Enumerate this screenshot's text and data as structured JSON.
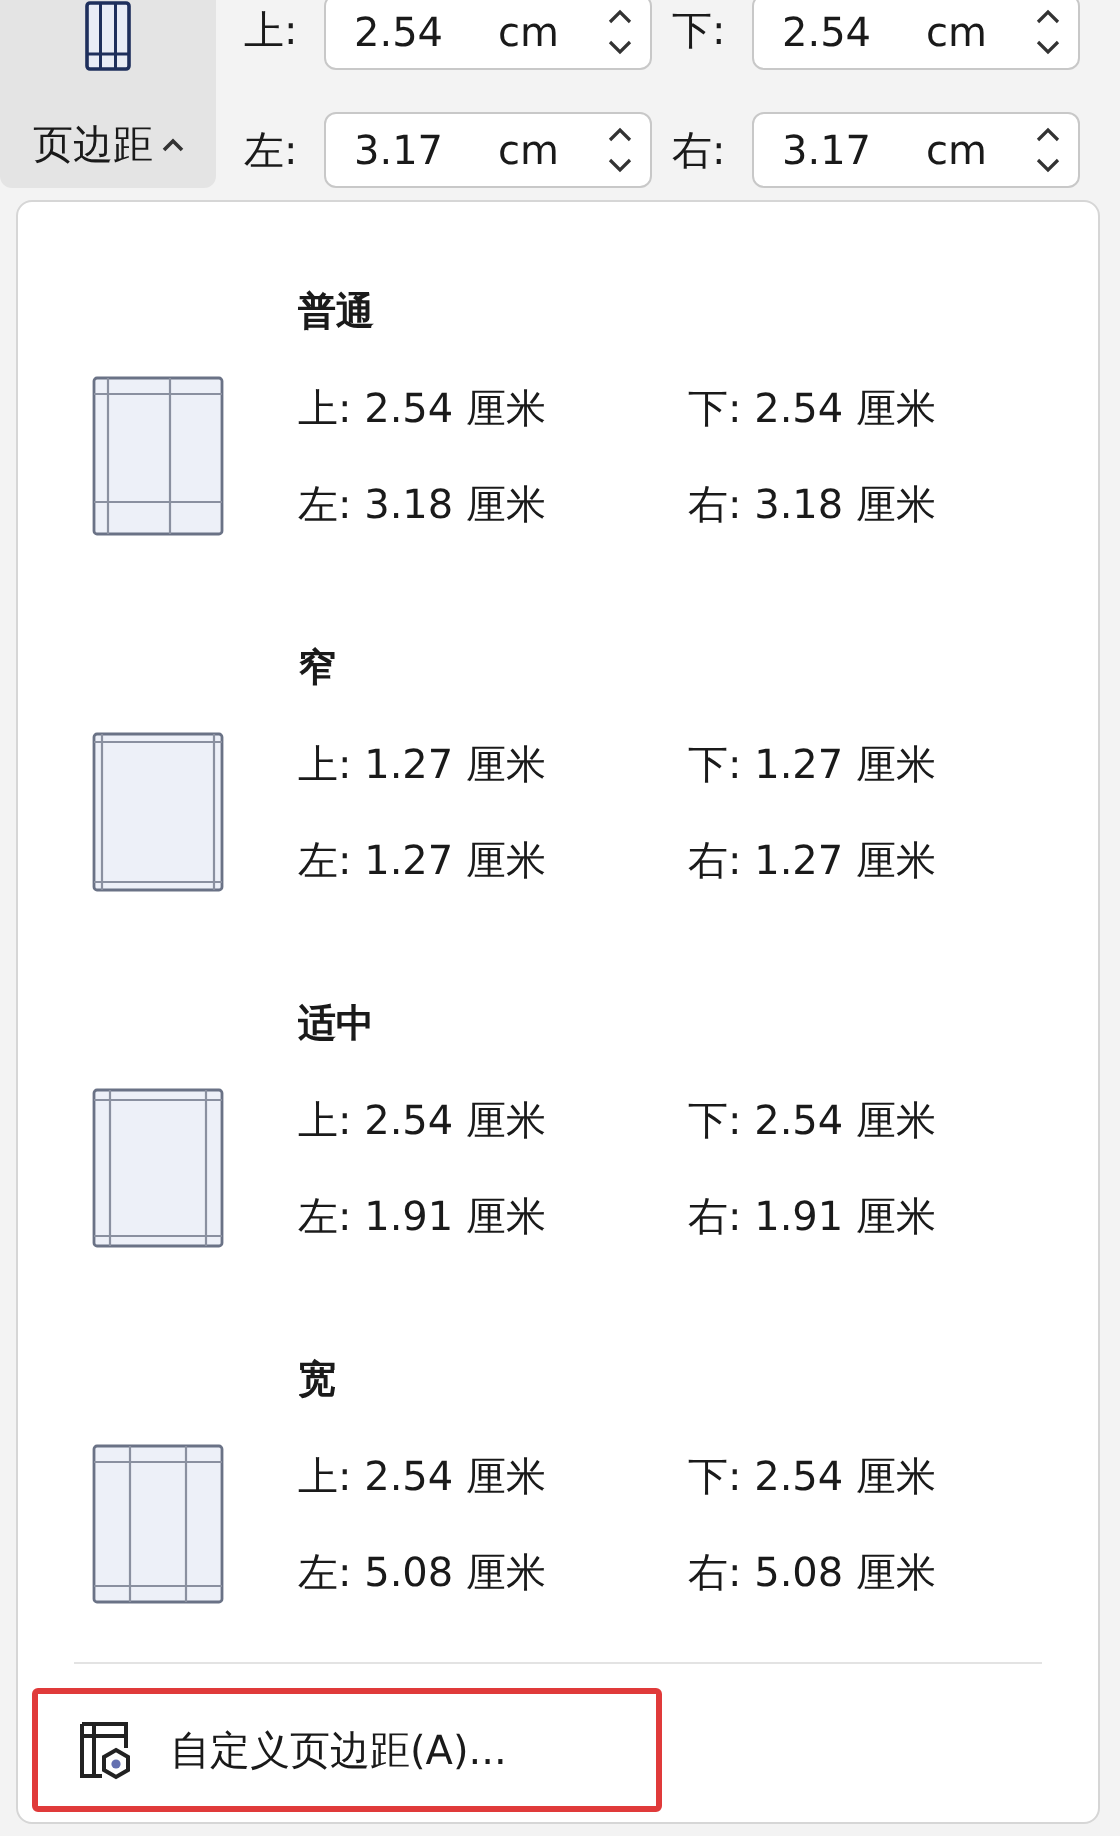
{
  "ribbon": {
    "margins_button": {
      "label": "页边距",
      "pressed": true
    },
    "fields": [
      {
        "label": "上:",
        "value": "2.54",
        "unit": "cm"
      },
      {
        "label": "下:",
        "value": "2.54",
        "unit": "cm"
      },
      {
        "label": "左:",
        "value": "3.17",
        "unit": "cm"
      },
      {
        "label": "右:",
        "value": "3.17",
        "unit": "cm"
      }
    ]
  },
  "menu": {
    "presets": [
      {
        "kind": "normal",
        "title": "普通",
        "values": [
          "上: 2.54 厘米",
          "下: 2.54 厘米",
          "左: 3.18 厘米",
          "右: 3.18 厘米"
        ]
      },
      {
        "kind": "narrow",
        "title": "窄",
        "values": [
          "上: 1.27 厘米",
          "下: 1.27 厘米",
          "左: 1.27 厘米",
          "右: 1.27 厘米"
        ]
      },
      {
        "kind": "moderate",
        "title": "适中",
        "values": [
          "上: 2.54 厘米",
          "下: 2.54 厘米",
          "左: 1.91 厘米",
          "右: 1.91 厘米"
        ]
      },
      {
        "kind": "wide",
        "title": "宽",
        "values": [
          "上: 2.54 厘米",
          "下: 2.54 厘米",
          "左: 5.08 厘米",
          "右: 5.08 厘米"
        ]
      }
    ],
    "custom_item": {
      "label": "自定义页边距(A)...",
      "highlighted": true
    }
  }
}
